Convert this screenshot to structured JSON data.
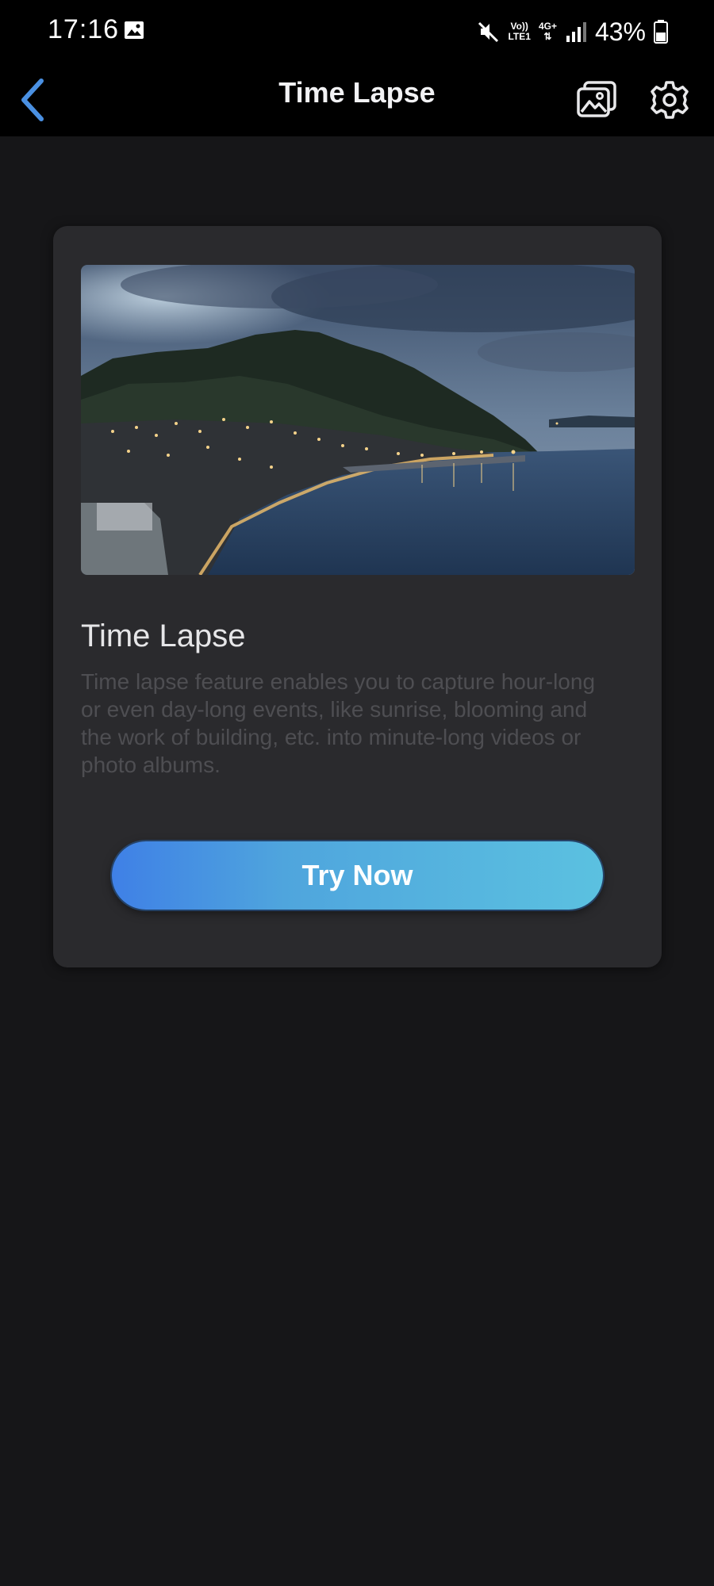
{
  "status_bar": {
    "time": "17:16",
    "net_top": "Vo))",
    "net_bottom": "LTE1",
    "net_gen": "4G+",
    "battery": "43%"
  },
  "app_bar": {
    "title": "Time Lapse",
    "icons": [
      "back-arrow-icon",
      "album-icon",
      "settings-icon"
    ],
    "accent_color": "#4a90e2"
  },
  "card": {
    "image_description": "coastal town at dusk",
    "title": "Time Lapse",
    "description": "Time lapse feature enables you to capture hour-long or even day-long events, like sunrise, blooming and the work of building, etc. into minute-long videos or photo albums.",
    "button_label": "Try Now",
    "button_gradient": [
      "#3f80e6",
      "#5bc1e0"
    ]
  }
}
